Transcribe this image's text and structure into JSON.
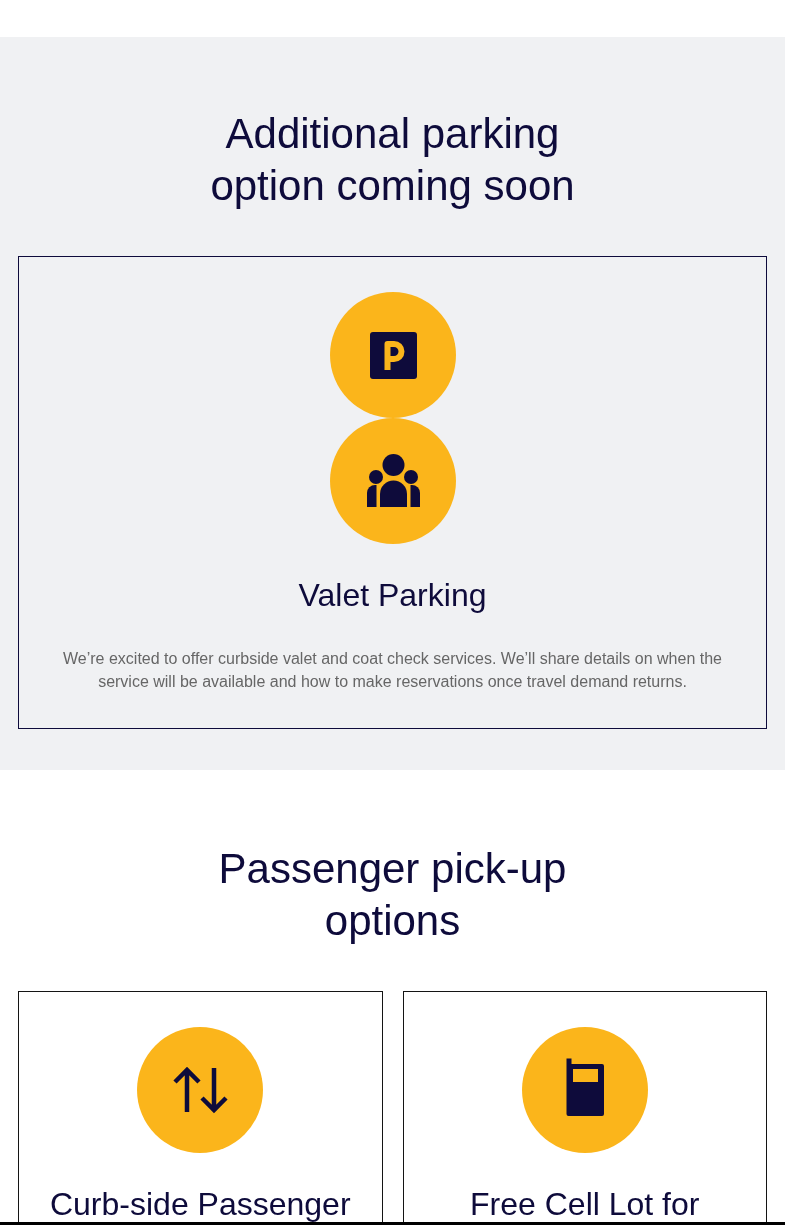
{
  "sections": [
    {
      "heading": "Additional parking option coming soon",
      "cards": [
        {
          "title": "Valet Parking",
          "text": "We’re excited to offer curbside valet and coat check services. We’ll share details on when the service will be available and how to make reservations once travel demand returns."
        }
      ]
    },
    {
      "heading": "Passenger pick-up options",
      "cards": [
        {
          "title": "Curb-side Passenger"
        },
        {
          "title": "Free Cell Lot for"
        }
      ]
    }
  ]
}
